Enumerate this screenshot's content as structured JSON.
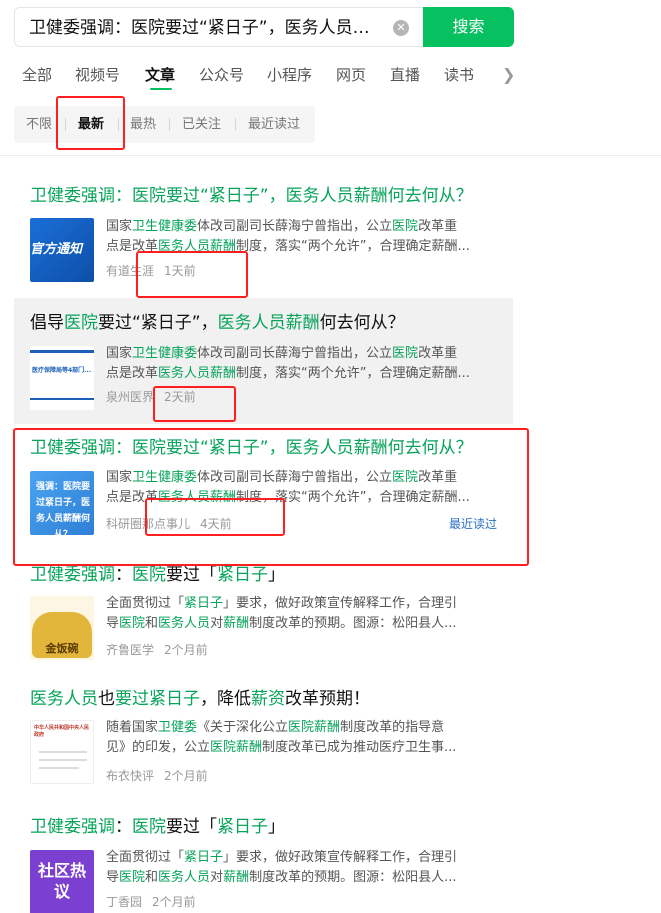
{
  "search": {
    "query": "卫健委强调：医院要过“紧日子”，医务人员薪酬何去何从？",
    "query_display": "卫健委强调：医院要过“紧日子”，医务人员薪...",
    "button": "搜索",
    "clear_icon": "clear-circle-icon"
  },
  "tabs": [
    "全部",
    "视频号",
    "文章",
    "公众号",
    "小程序",
    "网页",
    "直播",
    "读书"
  ],
  "active_tab": "文章",
  "filters": [
    "不限",
    "最新",
    "最热",
    "已关注",
    "最近读过"
  ],
  "active_filter": "最新",
  "colors": {
    "accent": "#07c160",
    "highlight": "#07a35a",
    "link": "#2b6fc7",
    "annotation": "#ff1f1f"
  },
  "results": [
    {
      "title": "卫健委强调：医院要过“紧日子”，医务人员薪酬何去何从？",
      "desc_line1": "国家卫生健康委体改司副司长薛海宁曾指出，公立医院改革重",
      "desc_line2": "点是改革医务人员薪酬制度，落实“两个允许”，合理确定薪酬...",
      "source": "有道生涯",
      "time": "1天前",
      "thumb_text": "官方通知"
    },
    {
      "title": "倡导医院要过“紧日子”，医务人员薪酬何去何从？",
      "desc_line1": "国家卫生健康委体改司副司长薛海宁曾指出，公立医院改革重",
      "desc_line2": "点是改革医务人员薪酬制度，落实“两个允许”，合理确定薪酬...",
      "source": "泉州医界",
      "time": "2天前",
      "thumb_text": "医疗保障局等4部门..."
    },
    {
      "title": "卫健委强调：医院要过“紧日子”，医务人员薪酬何去何从？",
      "desc_line1": "国家卫生健康委体改司副司长薛海宁曾指出，公立医院改革重",
      "desc_line2": "点是改革医务人员薪酬制度，落实“两个允许”，合理确定薪酬...",
      "source": "科研圈那点事儿",
      "time": "4天前",
      "thumb_text": "强调：医院要过紧日子，医务人员薪酬何从？",
      "extra_link": "最近读过"
    },
    {
      "title": "卫健委强调：医院要过「紧日子」",
      "desc_line1": "全面贯彻过「紧日子」要求，做好政策宣传解释工作，合理引",
      "desc_line2": "导医院和医务人员对薪酬制度改革的预期。图源：松阳县人...",
      "source": "齐鲁医学",
      "time": "2个月前",
      "thumb_text": "金饭碗"
    },
    {
      "title": "医务人员也要过紧日子，降低薪资改革预期！",
      "desc_line1": "随着国家卫健委《关于深化公立医院薪酬制度改革的指导意",
      "desc_line2": "见》的印发，公立医院薪酬制度改革已成为推动医疗卫生事...",
      "source": "布衣快评",
      "time": "2个月前",
      "thumb_text": "中华人民共和国中央人民政府"
    },
    {
      "title": "卫健委强调：医院要过「紧日子」",
      "desc_line1": "全面贯彻过「紧日子」要求，做好政策宣传解释工作，合理引",
      "desc_line2": "导医院和医务人员对薪酬制度改革的预期。图源：松阳县人...",
      "source": "丁香园",
      "time": "2个月前",
      "thumb_text": "社区热议"
    }
  ]
}
